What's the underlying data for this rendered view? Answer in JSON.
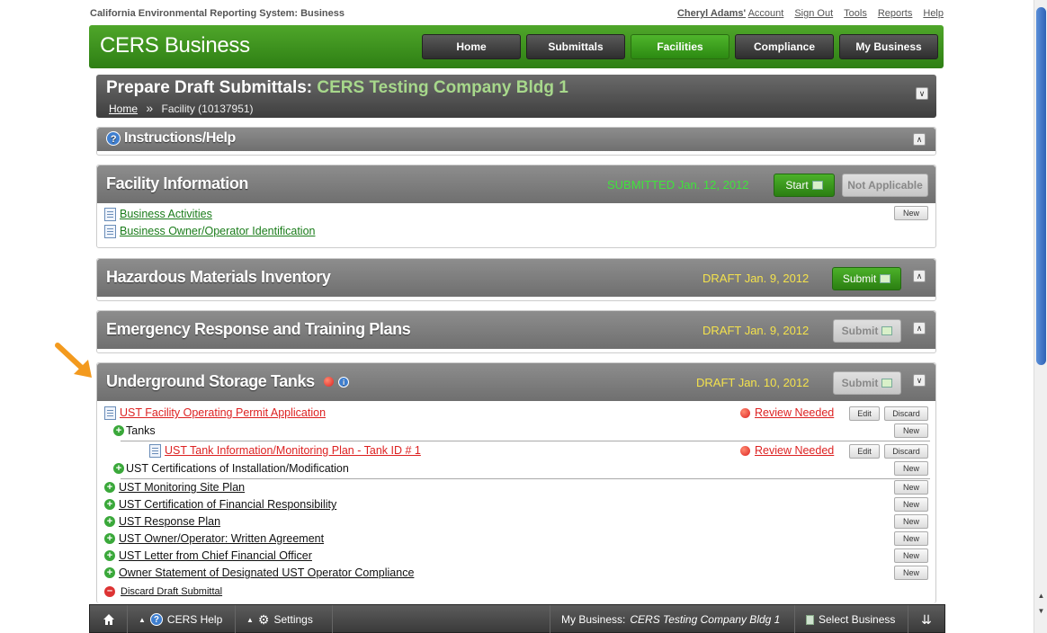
{
  "top": {
    "system_title": "California Environmental Reporting System: Business",
    "account_name": "Cheryl Adams'",
    "account_label": "Account",
    "links": [
      "Sign Out",
      "Tools",
      "Reports",
      "Help"
    ]
  },
  "header": {
    "brand": "CERS Business",
    "nav": [
      "Home",
      "Submittals",
      "Facilities",
      "Compliance",
      "My Business"
    ],
    "active_nav": "Facilities"
  },
  "title_panel": {
    "prefix": "Prepare Draft Submittals:",
    "facility": "CERS Testing Company Bldg 1",
    "breadcrumb_home": "Home",
    "breadcrumb_sep": "»",
    "breadcrumb_current": "Facility (10137951)"
  },
  "instructions": {
    "title": "Instructions/Help"
  },
  "facility_info": {
    "title": "Facility Information",
    "status": "SUBMITTED Jan. 12, 2012",
    "start_label": "Start",
    "na_label": "Not Applicable",
    "new_label": "New",
    "items": [
      "Business Activities",
      "Business Owner/Operator Identification"
    ]
  },
  "hmi": {
    "title": "Hazardous Materials Inventory",
    "status": "DRAFT Jan. 9, 2012",
    "submit_label": "Submit"
  },
  "ert": {
    "title": "Emergency Response and Training Plans",
    "status": "DRAFT Jan. 9, 2012",
    "submit_label": "Submit"
  },
  "ust": {
    "title": "Underground Storage Tanks",
    "status": "DRAFT Jan. 10, 2012",
    "submit_label": "Submit",
    "permit_app": "UST Facility Operating Permit Application",
    "review_needed": "Review Needed",
    "edit_label": "Edit",
    "discard_label": "Discard",
    "new_label": "New",
    "tanks_label": "Tanks",
    "tank_item": "UST Tank Information/Monitoring Plan - Tank ID # 1",
    "certifications": "UST Certifications of Installation/Modification",
    "links": [
      "UST Monitoring Site Plan",
      "UST Certification of Financial Responsibility",
      "UST Response Plan",
      "UST Owner/Operator: Written Agreement",
      "UST Letter from Chief Financial Officer",
      "Owner Statement of Designated UST Operator Compliance"
    ],
    "discard_draft": "Discard Draft Submittal"
  },
  "bottom_bar": {
    "help": "CERS Help",
    "settings": "Settings",
    "my_business_label": "My Business:",
    "my_business_value": "CERS Testing Company Bldg 1",
    "select_business": "Select Business"
  },
  "colors": {
    "brand_green": "#3a9420",
    "status_draft": "#f4e24c",
    "status_submitted": "#3fe43b",
    "review_red": "#d22222"
  }
}
